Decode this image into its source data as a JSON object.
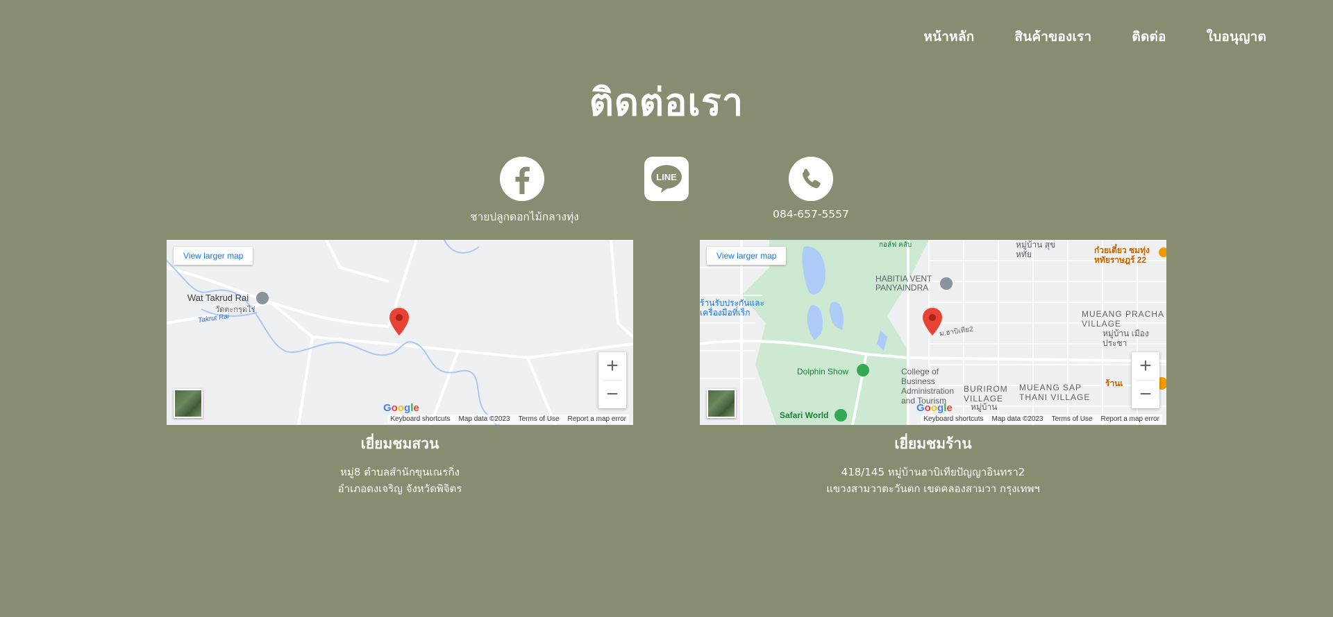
{
  "nav": {
    "items": [
      {
        "label": "หน้าหลัก"
      },
      {
        "label": "สินค้าของเรา"
      },
      {
        "label": "ติดต่อ"
      },
      {
        "label": "ใบอนุญาต"
      }
    ]
  },
  "page_title": "ติดต่อเรา",
  "social": {
    "facebook": {
      "icon": "facebook-icon",
      "caption": "ชายปลูกดอกไม้กลางทุ่ง"
    },
    "line": {
      "icon": "line-icon",
      "badge": "LINE"
    },
    "phone": {
      "icon": "phone-icon",
      "caption": "084-657-5557"
    }
  },
  "maps": [
    {
      "view_larger": "View larger map",
      "labels": {
        "place1": "Wat Takrud Rai",
        "place1_th": "วัดตะกรุดไร่",
        "river": "Takrut Rai"
      },
      "google": "Google",
      "footer": {
        "shortcuts": "Keyboard shortcuts",
        "mapdata": "Map data ©2023",
        "terms": "Terms of Use",
        "report": "Report a map error"
      },
      "title": "เยี่ยมชมสวน",
      "address_line1": "หมู่8 ตำบลสำนักขุนเณรกิ่ง",
      "address_line2": "อำเภอดงเจริญ จังหวัดพิจิตร"
    },
    {
      "view_larger": "View larger map",
      "labels": {
        "habitia": "HABITIA VENT PANYAINDRA",
        "dolphin": "Dolphin Show",
        "safari": "Safari World",
        "college": "College of Business Administration and Tourism",
        "burirom": "BURIROM VILLAGE",
        "mueangsap": "MUEANG SAP THANI VILLAGE",
        "mueangpracha": "MUEANG PRACHA VILLAGE",
        "moo_suksai": "หมู่บ้าน สุขหทัย",
        "noodle": "ก๋วยเตี๋ยว ชมทุ่ง",
        "noodle2": "หทัยราษฎร์ 22",
        "store": "ร้านรับประกันและเครื่องมือที่เร็ก",
        "golf": "กอล์ฟ คลับ",
        "road": "ม.ฮาบิเทีย2",
        "moo_pracha": "หมู่บ้าน เมืองประชา",
        "moo_bottom": "หมู่บ้าน",
        "shop": "ร้านเ"
      },
      "google": "Google",
      "footer": {
        "shortcuts": "Keyboard shortcuts",
        "mapdata": "Map data ©2023",
        "terms": "Terms of Use",
        "report": "Report a map error"
      },
      "title": "เยี่ยมชมร้าน",
      "address_line1": "418/145 หมู่บ้านฮาบิเทียปัญญาอินทรา2",
      "address_line2": "แขวงสามวาตะวันตก เขตคลองสามวา กรุงเทพฯ"
    }
  ],
  "colors": {
    "background": "#878d70",
    "text": "#ffffff",
    "pin": "#ea4335",
    "link": "#1a73e8"
  }
}
